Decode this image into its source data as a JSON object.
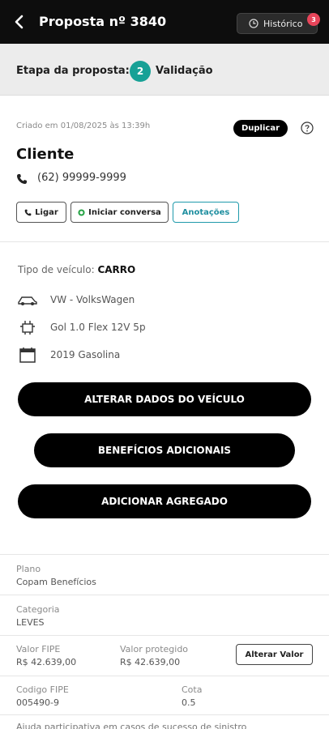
{
  "header": {
    "title": "Proposta nº 3840",
    "history_label": "Histórico",
    "history_badge": "3"
  },
  "stage": {
    "label": "Etapa da proposta:",
    "number": "2",
    "name": "Validação",
    "accent_color": "#17a196"
  },
  "client": {
    "created": "Criado em 01/08/2025 às 13:39h",
    "duplicate_label": "Duplicar",
    "title": "Cliente",
    "phone": "(62) 99999-9999",
    "actions": {
      "call": "Ligar",
      "chat": "Iniciar conversa",
      "notes": "Anotações"
    }
  },
  "vehicle": {
    "type_label": "Tipo de veículo:",
    "type_value": "CARRO",
    "brand": "VW - VolksWagen",
    "model": "Gol 1.0 Flex 12V 5p",
    "year": "2019 Gasolina"
  },
  "buttons": {
    "alter_vehicle": "ALTERAR DADOS DO VEÍCULO",
    "benefits": "BENEFÍCIOS ADICIONAIS",
    "add_aggregate": "ADICIONAR AGREGADO"
  },
  "details": {
    "plan_label": "Plano",
    "plan_value": "Copam Benefícios",
    "category_label": "Categoria",
    "category_value": "LEVES",
    "fipe_label": "Valor FIPE",
    "fipe_value": "R$ 42.639,00",
    "protected_label": "Valor protegido",
    "protected_value": "R$ 42.639,00",
    "alter_value_label": "Alterar Valor",
    "fipe_code_label": "Codigo FIPE",
    "fipe_code_value": "005490-9",
    "quota_label": "Cota",
    "quota_value": "0.5",
    "cut_text": "Ajuda participativa em casos de sucesso de sinistro"
  }
}
